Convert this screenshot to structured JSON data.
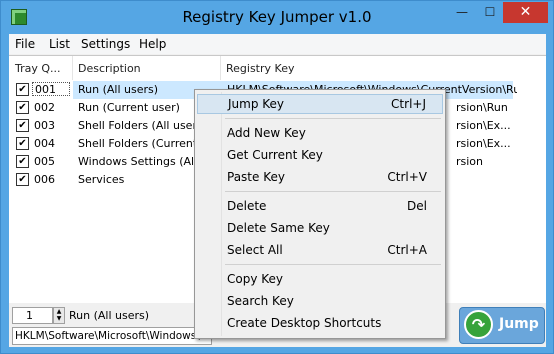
{
  "window": {
    "title": "Registry Key Jumper v1.0"
  },
  "caption": {
    "minimize": "—",
    "maximize": "☐",
    "close": "✕"
  },
  "menubar": [
    "File",
    "List",
    "Settings",
    "Help"
  ],
  "columns": [
    "Tray Q...",
    "Description",
    "Registry Key"
  ],
  "rows": [
    {
      "checked": true,
      "num": "001",
      "desc": "Run (All users)",
      "key": "HKLM\\Software\\Microsoft\\Windows\\CurrentVersion\\Run",
      "selected": true
    },
    {
      "checked": true,
      "num": "002",
      "desc": "Run (Current user)",
      "key": "rsion\\Run"
    },
    {
      "checked": true,
      "num": "003",
      "desc": "Shell Folders (All users)",
      "key": "rsion\\Ex..."
    },
    {
      "checked": true,
      "num": "004",
      "desc": "Shell Folders (Current u",
      "key": "rsion\\Ex..."
    },
    {
      "checked": true,
      "num": "005",
      "desc": "Windows Settings (All us",
      "key": "rsion"
    },
    {
      "checked": true,
      "num": "006",
      "desc": "Services",
      "key": ""
    }
  ],
  "bottom": {
    "spin_value": "1",
    "current_desc": "Run (All users)",
    "path": "HKLM\\Software\\Microsoft\\Windows\\C",
    "jump_label": "Jump"
  },
  "context_menu": {
    "items": [
      {
        "label": "Jump Key",
        "shortcut": "Ctrl+J",
        "highlighted": true
      },
      {
        "label": "Add New Key",
        "shortcut": ""
      },
      {
        "label": "Get Current Key",
        "shortcut": ""
      },
      {
        "label": "Paste Key",
        "shortcut": "Ctrl+V"
      },
      {
        "label": "Delete",
        "shortcut": "Del"
      },
      {
        "label": "Delete Same Key",
        "shortcut": ""
      },
      {
        "label": "Select All",
        "shortcut": "Ctrl+A"
      },
      {
        "label": "Copy Key",
        "shortcut": ""
      },
      {
        "label": "Search Key",
        "shortcut": ""
      },
      {
        "label": "Create Desktop Shortcuts",
        "shortcut": ""
      }
    ]
  }
}
